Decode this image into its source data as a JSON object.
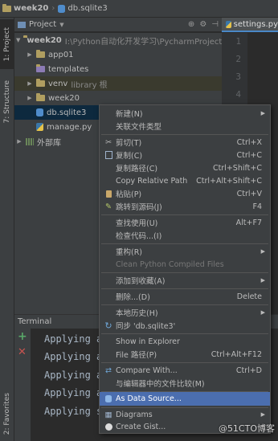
{
  "breadcrumb": {
    "project": "week20",
    "file": "db.sqlite3"
  },
  "left_strip": {
    "project_tab": "1: Project",
    "structure_tab": "7: Structure",
    "favorites_tab": "2: Favorites"
  },
  "project_header": {
    "title": "Project"
  },
  "tree": {
    "root": {
      "name": "week20",
      "path": "I:\\Python自动化开发学习\\PycharmProjects\\w"
    },
    "items": [
      {
        "name": "app01"
      },
      {
        "name": "templates"
      },
      {
        "name": "venv",
        "hint": "library 根"
      },
      {
        "name": "week20"
      },
      {
        "name": "db.sqlite3"
      },
      {
        "name": "manage.py"
      },
      {
        "name": "外部库"
      }
    ]
  },
  "editor": {
    "tab": "settings.py",
    "line_numbers": [
      "1",
      "2",
      "3",
      "4"
    ]
  },
  "terminal": {
    "title": "Terminal",
    "lines": [
      "Applying a",
      "Applying a",
      "Applying a",
      "Applying a",
      "Applying s"
    ]
  },
  "menu": {
    "items": [
      {
        "label": "新建(N)"
      },
      {
        "label": "关联文件类型"
      },
      {
        "label": "剪切(T)",
        "shortcut": "Ctrl+X"
      },
      {
        "label": "复制(C)",
        "shortcut": "Ctrl+C"
      },
      {
        "label": "复制路径(C)",
        "shortcut": "Ctrl+Shift+C"
      },
      {
        "label": "Copy Relative Path",
        "shortcut": "Ctrl+Alt+Shift+C"
      },
      {
        "label": "粘贴(P)",
        "shortcut": "Ctrl+V"
      },
      {
        "label": "跳转到源码(J)",
        "shortcut": "F4"
      },
      {
        "label": "查找使用(U)",
        "shortcut": "Alt+F7"
      },
      {
        "label": "检查代码...(I)"
      },
      {
        "label": "重构(R)"
      },
      {
        "label": "Clean Python Compiled Files"
      },
      {
        "label": "添加到收藏(A)"
      },
      {
        "label": "删除...(D)",
        "shortcut": "Delete"
      },
      {
        "label": "本地历史(H)"
      },
      {
        "label": "同步 'db.sqlite3'"
      },
      {
        "label": "Show in Explorer"
      },
      {
        "label": "File 路径(P)",
        "shortcut": "Ctrl+Alt+F12"
      },
      {
        "label": "Compare With...",
        "shortcut": "Ctrl+D"
      },
      {
        "label": "与编辑器中的文件比较(M)"
      },
      {
        "label": "As Data Source..."
      },
      {
        "label": "Diagrams"
      },
      {
        "label": "Create Gist..."
      }
    ]
  },
  "watermark": "@51CTO博客",
  "colors": {
    "selection": "#4b6eaf",
    "panel": "#3c3f41",
    "editor_bg": "#2b2b2b",
    "tree_highlight": "#0d293e"
  }
}
